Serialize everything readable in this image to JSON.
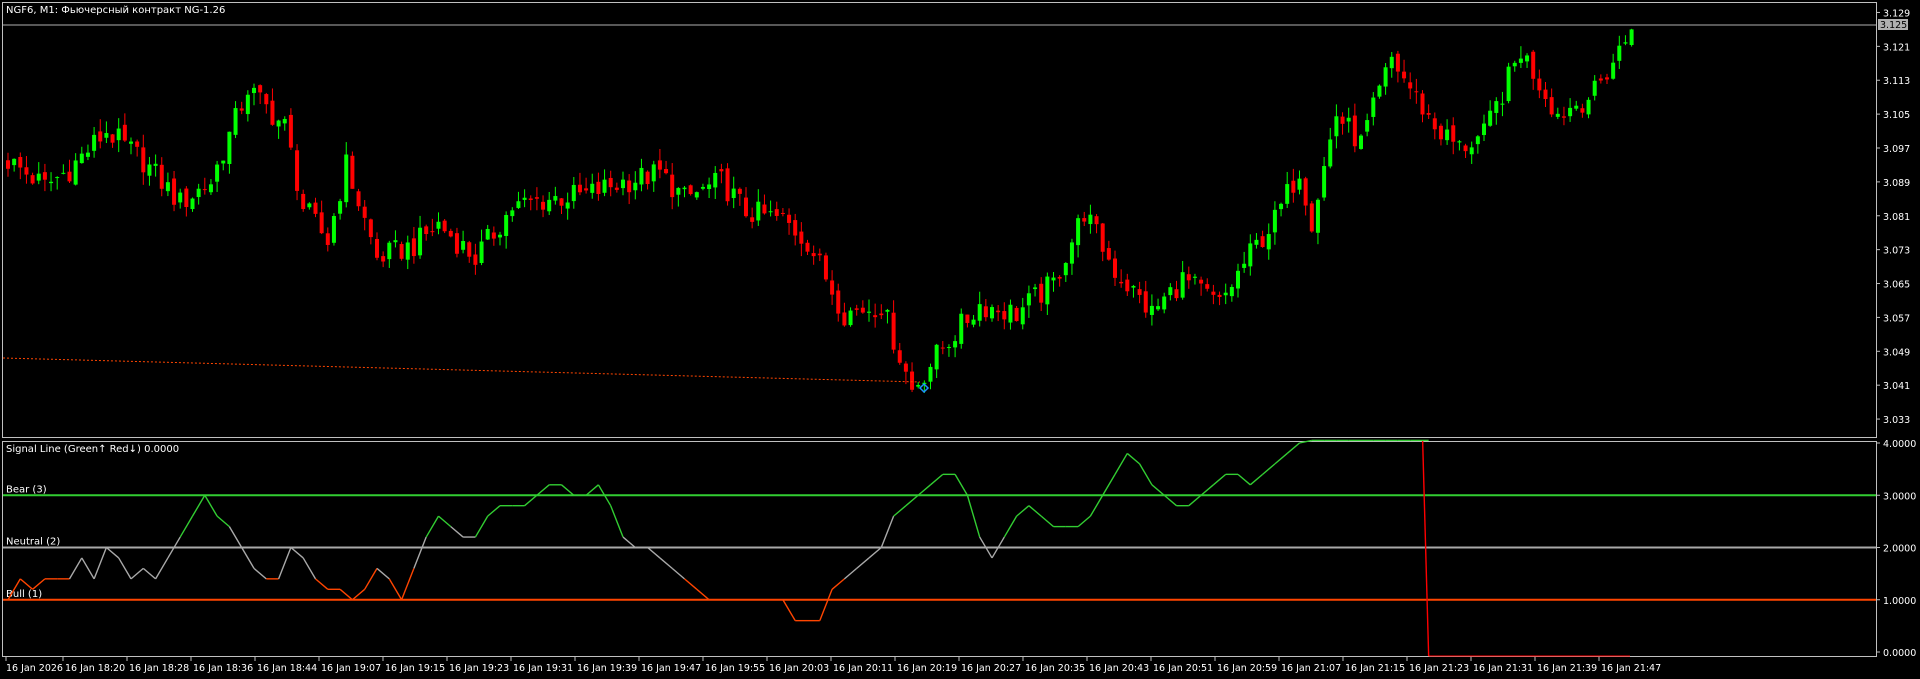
{
  "window": {
    "title": "NGF6, M1:  Фьючерсный контракт NG-1.26"
  },
  "subwindow": {
    "title": "Signal Line (Green↑ Red↓) 0.0000",
    "levels": [
      {
        "label": "Bear (3)",
        "value": 3,
        "color": "#32cd32"
      },
      {
        "label": "Neutral (2)",
        "value": 2,
        "color": "#a9a9a9"
      },
      {
        "label": "Bull (1)",
        "value": 1,
        "color": "#ff4500"
      }
    ]
  },
  "price_axis": {
    "ticks": [
      "3.129",
      "3.121",
      "3.113",
      "3.105",
      "3.097",
      "3.089",
      "3.081",
      "3.073",
      "3.065",
      "3.057",
      "3.049",
      "3.041",
      "3.033"
    ],
    "current_price": "3.125"
  },
  "indicator_axis": {
    "ticks": [
      "4.0000",
      "3.0000",
      "2.0000",
      "1.0000",
      "0.0000"
    ]
  },
  "time_axis": {
    "labels": [
      "16 Jan 2026",
      "16 Jan 18:20",
      "16 Jan 18:28",
      "16 Jan 18:36",
      "16 Jan 18:44",
      "16 Jan 19:07",
      "16 Jan 19:15",
      "16 Jan 19:23",
      "16 Jan 19:31",
      "16 Jan 19:39",
      "16 Jan 19:47",
      "16 Jan 19:55",
      "16 Jan 20:03",
      "16 Jan 20:11",
      "16 Jan 20:19",
      "16 Jan 20:27",
      "16 Jan 20:35",
      "16 Jan 20:43",
      "16 Jan 20:51",
      "16 Jan 20:59",
      "16 Jan 21:07",
      "16 Jan 21:15",
      "16 Jan 21:23",
      "16 Jan 21:31",
      "16 Jan 21:39",
      "16 Jan 21:47"
    ]
  },
  "colors": {
    "bull_candle": "#00ff00",
    "bear_candle": "#ff0000",
    "grid": "#c0c0c0",
    "ask_line": "#ff4500"
  },
  "chart_data": [
    {
      "type": "candlestick",
      "ylim": [
        3.029,
        3.131
      ],
      "close_anchors": [
        [
          0,
          3.094
        ],
        [
          6,
          3.088
        ],
        [
          10,
          3.092
        ],
        [
          16,
          3.101
        ],
        [
          22,
          3.094
        ],
        [
          28,
          3.084
        ],
        [
          33,
          3.089
        ],
        [
          39,
          3.111
        ],
        [
          45,
          3.102
        ],
        [
          48,
          3.083
        ],
        [
          52,
          3.075
        ],
        [
          55,
          3.093
        ],
        [
          60,
          3.071
        ],
        [
          66,
          3.074
        ],
        [
          70,
          3.079
        ],
        [
          76,
          3.071
        ],
        [
          82,
          3.083
        ],
        [
          88,
          3.085
        ],
        [
          94,
          3.086
        ],
        [
          100,
          3.089
        ],
        [
          106,
          3.091
        ],
        [
          110,
          3.085
        ],
        [
          116,
          3.089
        ],
        [
          120,
          3.082
        ],
        [
          126,
          3.08
        ],
        [
          130,
          3.075
        ],
        [
          136,
          3.058
        ],
        [
          142,
          3.06
        ],
        [
          147,
          3.04
        ],
        [
          152,
          3.05
        ],
        [
          158,
          3.06
        ],
        [
          164,
          3.058
        ],
        [
          170,
          3.065
        ],
        [
          175,
          3.082
        ],
        [
          180,
          3.068
        ],
        [
          186,
          3.058
        ],
        [
          191,
          3.066
        ],
        [
          197,
          3.06
        ],
        [
          202,
          3.072
        ],
        [
          206,
          3.08
        ],
        [
          210,
          3.092
        ],
        [
          212,
          3.08
        ],
        [
          216,
          3.105
        ],
        [
          220,
          3.098
        ],
        [
          225,
          3.118
        ],
        [
          232,
          3.102
        ],
        [
          236,
          3.097
        ],
        [
          240,
          3.1
        ],
        [
          246,
          3.12
        ],
        [
          252,
          3.105
        ],
        [
          258,
          3.11
        ],
        [
          262,
          3.12
        ],
        [
          264,
          3.125
        ]
      ]
    },
    {
      "type": "line",
      "name": "Signal Line",
      "ylim": [
        0,
        4
      ],
      "x": [
        0,
        2,
        4,
        6,
        8,
        10,
        12,
        14,
        16,
        18,
        20,
        22,
        24,
        26,
        28,
        30,
        32,
        34,
        36,
        38,
        40,
        42,
        44,
        46,
        48,
        50,
        52,
        54,
        56,
        58,
        60,
        62,
        64,
        66,
        68,
        70,
        72,
        74,
        76,
        78,
        80,
        82,
        84,
        86,
        88,
        90,
        92,
        94,
        96,
        98,
        100,
        102,
        104,
        106,
        108,
        110,
        112,
        114,
        116,
        118,
        120,
        122,
        124,
        126,
        128,
        130,
        132,
        134,
        136,
        138,
        140,
        142,
        144,
        146,
        148,
        150,
        152,
        154,
        156,
        158,
        160,
        162,
        164,
        166,
        168,
        170,
        172,
        174,
        176,
        178,
        180,
        182,
        184,
        186,
        188,
        190,
        192,
        194,
        196,
        198,
        200,
        202,
        204,
        206,
        208,
        210,
        212,
        214,
        216,
        218,
        220,
        222,
        224,
        226,
        228,
        230,
        231
      ],
      "values": [
        1.0,
        1.4,
        1.2,
        1.4,
        1.4,
        1.4,
        1.8,
        1.4,
        2.0,
        1.8,
        1.4,
        1.6,
        1.4,
        1.8,
        2.2,
        2.6,
        3.0,
        2.6,
        2.4,
        2.0,
        1.6,
        1.4,
        1.4,
        2.0,
        1.8,
        1.4,
        1.2,
        1.2,
        1.0,
        1.2,
        1.6,
        1.4,
        1.0,
        1.6,
        2.2,
        2.6,
        2.4,
        2.2,
        2.2,
        2.6,
        2.8,
        2.8,
        2.8,
        3.0,
        3.2,
        3.2,
        3.0,
        3.0,
        3.2,
        2.8,
        2.2,
        2.0,
        2.0,
        1.8,
        1.6,
        1.4,
        1.2,
        1.0,
        1.0,
        1.0,
        1.0,
        1.0,
        1.0,
        1.0,
        0.6,
        0.6,
        0.6,
        1.2,
        1.4,
        1.6,
        1.8,
        2.0,
        2.6,
        2.8,
        3.0,
        3.2,
        3.4,
        3.4,
        3.0,
        2.2,
        1.8,
        2.2,
        2.6,
        2.8,
        2.6,
        2.4,
        2.4,
        2.4,
        2.6,
        3.0,
        3.4,
        3.8,
        3.6,
        3.2,
        3.0,
        2.8,
        2.8,
        3.0,
        3.2,
        3.4,
        3.4,
        3.2,
        3.4,
        3.6,
        3.8,
        4.0,
        4.2,
        4.2,
        4.2,
        4.2,
        4.2,
        4.2,
        4.2,
        4.2,
        4.2,
        4.2,
        4.2
      ]
    }
  ]
}
